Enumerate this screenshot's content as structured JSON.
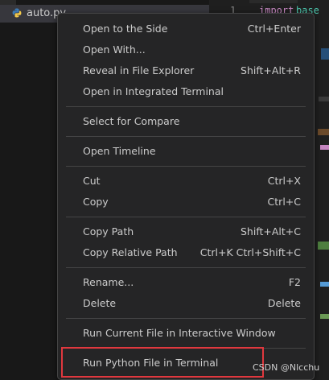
{
  "explorer": {
    "file_name": "auto.py",
    "file_icon": "python-file-icon"
  },
  "editor": {
    "line_number": "1",
    "keyword": "import",
    "module": "base"
  },
  "context_menu": {
    "groups": [
      [
        {
          "label": "Open to the Side",
          "shortcut": "Ctrl+Enter"
        },
        {
          "label": "Open With...",
          "shortcut": ""
        },
        {
          "label": "Reveal in File Explorer",
          "shortcut": "Shift+Alt+R"
        },
        {
          "label": "Open in Integrated Terminal",
          "shortcut": ""
        }
      ],
      [
        {
          "label": "Select for Compare",
          "shortcut": ""
        }
      ],
      [
        {
          "label": "Open Timeline",
          "shortcut": ""
        }
      ],
      [
        {
          "label": "Cut",
          "shortcut": "Ctrl+X"
        },
        {
          "label": "Copy",
          "shortcut": "Ctrl+C"
        }
      ],
      [
        {
          "label": "Copy Path",
          "shortcut": "Shift+Alt+C"
        },
        {
          "label": "Copy Relative Path",
          "shortcut": "Ctrl+K Ctrl+Shift+C"
        }
      ],
      [
        {
          "label": "Rename...",
          "shortcut": "F2"
        },
        {
          "label": "Delete",
          "shortcut": "Delete"
        }
      ],
      [
        {
          "label": "Run Current File in Interactive Window",
          "shortcut": ""
        }
      ],
      [
        {
          "label": "Run Python File in Terminal",
          "shortcut": ""
        }
      ]
    ]
  },
  "highlight_color": "#e0383e",
  "watermark": "CSDN @Nlcchu"
}
